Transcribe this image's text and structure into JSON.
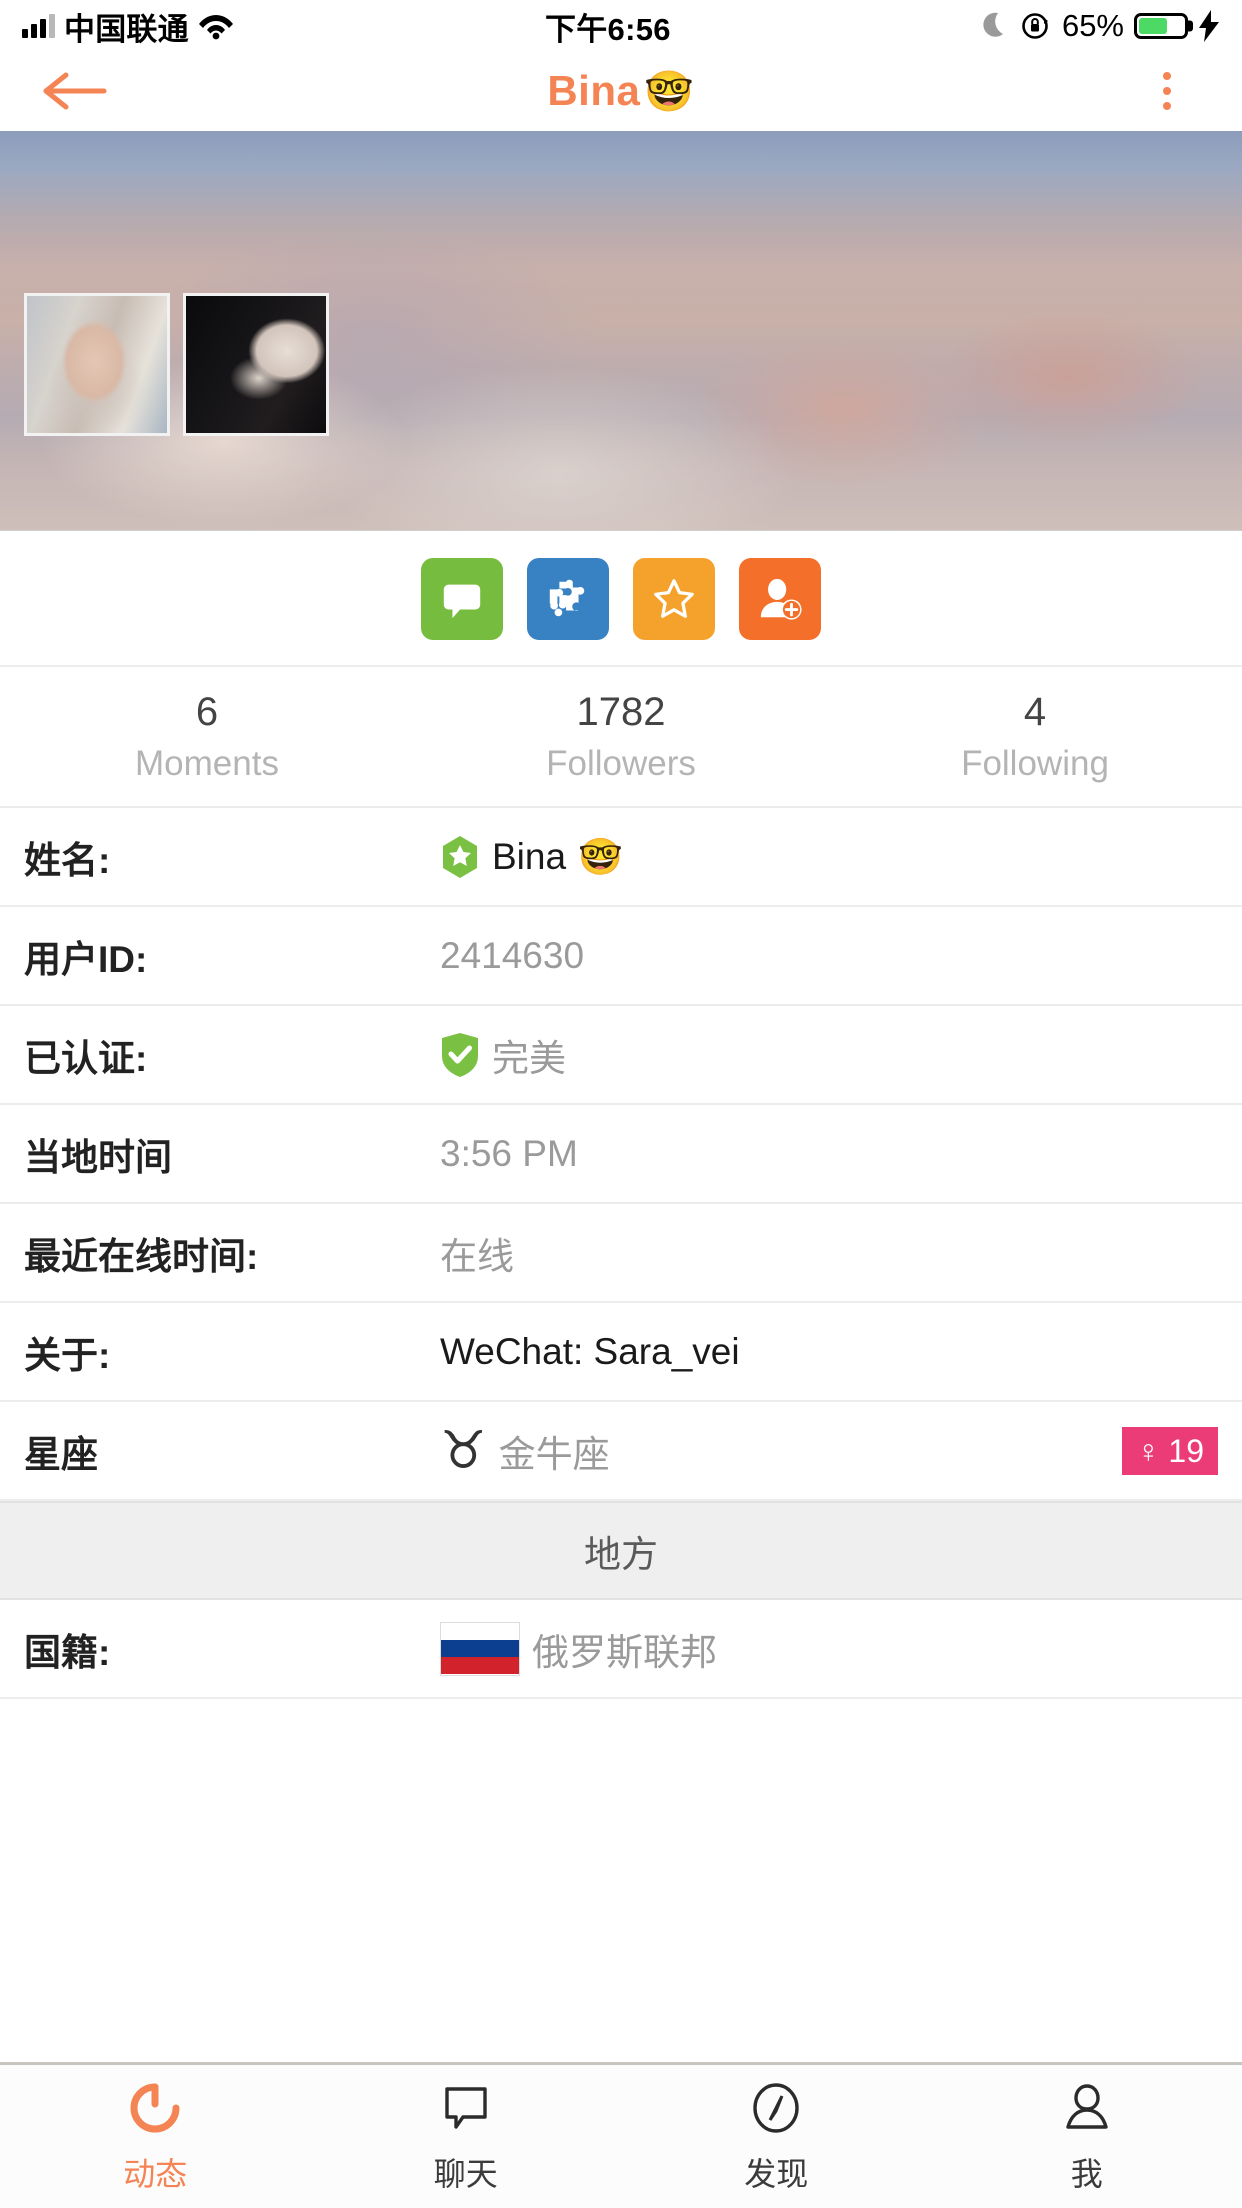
{
  "status_bar": {
    "carrier": "中国联通",
    "time": "下午6:56",
    "battery_percent": "65%",
    "battery_color": "#4cd964",
    "icons": [
      "signal-bars-icon",
      "wifi-icon",
      "moon-dnd-icon",
      "rotation-lock-icon",
      "battery-icon",
      "charging-bolt-icon"
    ]
  },
  "navbar": {
    "back_icon": "back-arrow-icon",
    "title": "Bina",
    "title_emoji": "🤓",
    "more_icon": "more-vertical-icon",
    "accent_color": "#f58454"
  },
  "cover": {
    "photos": [
      "profile-photo-1",
      "profile-photo-2"
    ]
  },
  "actions": [
    {
      "name": "message",
      "icon": "chat-bubble-icon",
      "color": "#76bc3f"
    },
    {
      "name": "games",
      "icon": "puzzle-pieces-icon",
      "color": "#3881c2"
    },
    {
      "name": "favorite",
      "icon": "star-outline-icon",
      "color": "#f4a22b"
    },
    {
      "name": "add-friend",
      "icon": "person-add-icon",
      "color": "#f4702a"
    }
  ],
  "stats": [
    {
      "value": "6",
      "label": "Moments"
    },
    {
      "value": "1782",
      "label": "Followers"
    },
    {
      "value": "4",
      "label": "Following"
    }
  ],
  "info_rows": [
    {
      "label": "姓名:",
      "value": "Bina",
      "emoji": "🤓",
      "icon": "verified-star-badge-icon"
    },
    {
      "label": "用户ID:",
      "value": "2414630"
    },
    {
      "label": "已认证:",
      "value": "完美",
      "icon": "green-shield-check-icon"
    },
    {
      "label": "当地时间",
      "value": "3:56 PM"
    },
    {
      "label": "最近在线时间:",
      "value": "在线"
    },
    {
      "label": "关于:",
      "value": "WeChat: Sara_vei",
      "dark": true
    }
  ],
  "zodiac_row": {
    "label": "星座",
    "glyph": "♉",
    "value": "金牛座",
    "gender_symbol": "♀",
    "age": "19",
    "badge_color": "#ec3c78"
  },
  "section_header": "地方",
  "nationality_row": {
    "label": "国籍:",
    "value": "俄罗斯联邦",
    "flag": "russia-flag-icon",
    "flag_colors": [
      "#ffffff",
      "#0c3f8f",
      "#d2222b"
    ]
  },
  "tabbar": [
    {
      "label": "动态",
      "icon": "moments-refresh-icon",
      "active": true
    },
    {
      "label": "聊天",
      "icon": "chat-bubble-outline-icon",
      "active": false
    },
    {
      "label": "发现",
      "icon": "compass-icon",
      "active": false
    },
    {
      "label": "我",
      "icon": "person-icon",
      "active": false
    }
  ]
}
